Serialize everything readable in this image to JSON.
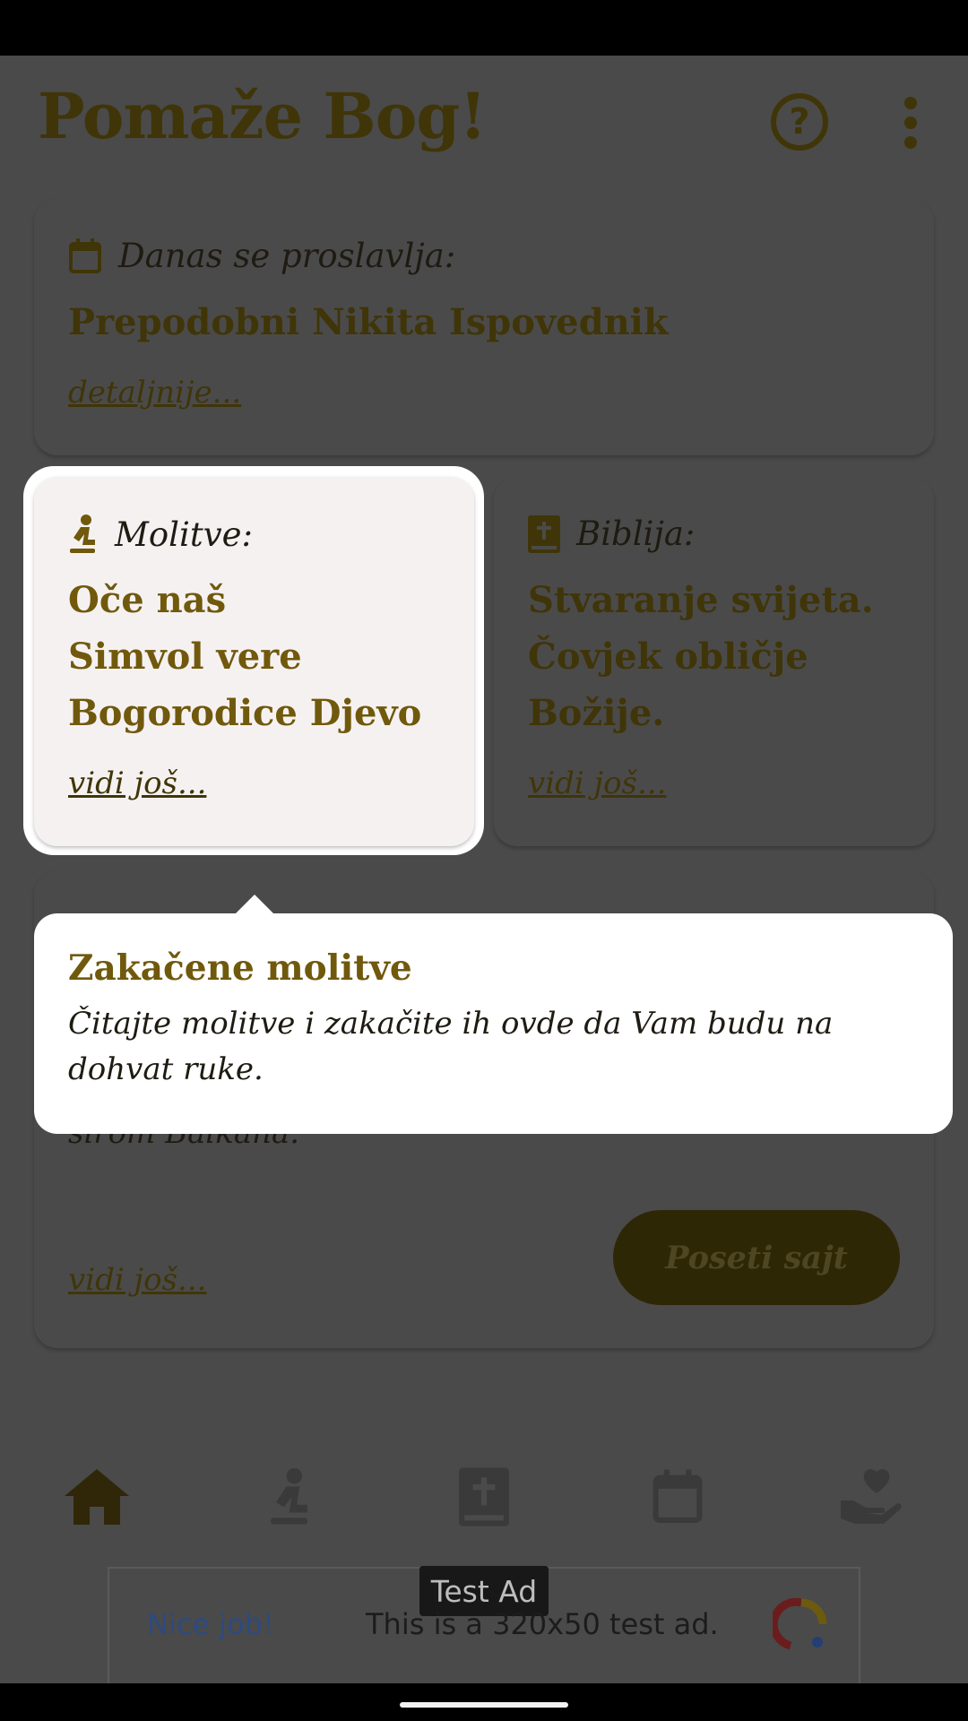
{
  "app": {
    "title": "Pomaže Bog!"
  },
  "header": {
    "help_icon_glyph": "?"
  },
  "feast_card": {
    "heading": "Danas se proslavlja:",
    "saint": "Prepodobni Nikita Ispovednik",
    "link": "detaljnije..."
  },
  "prayers_card": {
    "heading": "Molitve:",
    "items": [
      "Oče naš",
      "Simvol vere",
      "Bogorodice Djevo"
    ],
    "link": "vidi još..."
  },
  "bible_card": {
    "heading": "Biblija:",
    "lines": [
      "Stvaranje svijeta.",
      "Čovjek obličje",
      "Božije."
    ],
    "link": "vidi još..."
  },
  "site_card": {
    "text_tail": "širom Balkana.",
    "button": "Poseti sajt",
    "link": "vidi još..."
  },
  "tooltip": {
    "title": "Zakačene molitve",
    "text": "Čitajte molitve i zakačite ih ovde da Vam budu na dohvat ruke."
  },
  "bottom_nav": {
    "items": [
      {
        "icon": "home-icon",
        "selected": true
      },
      {
        "icon": "praying-icon"
      },
      {
        "icon": "bible-icon"
      },
      {
        "icon": "calendar-icon"
      },
      {
        "icon": "donate-heart-icon"
      }
    ]
  },
  "ad": {
    "label": "Test Ad",
    "nice": "Nice job!",
    "text": "This is a 320x50 test ad."
  },
  "colors": {
    "scrim": "#4a4a4a",
    "title_dark": "#3f3508",
    "accent": "#70590c",
    "highlight_card": "#f6f1f1"
  }
}
